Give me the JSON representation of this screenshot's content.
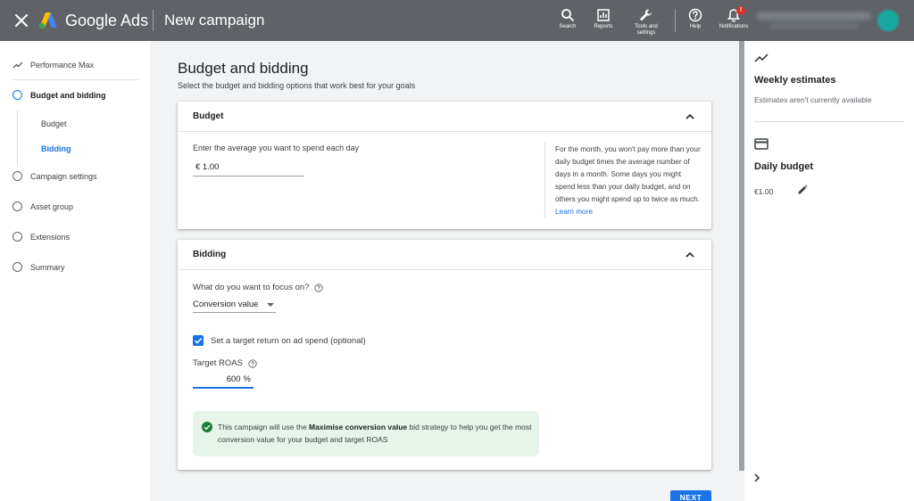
{
  "header": {
    "brand": "Google Ads",
    "title": "New campaign",
    "tools": [
      {
        "label": "Search",
        "icon": "search-icon"
      },
      {
        "label": "Reports",
        "icon": "reports-icon"
      },
      {
        "label": "Tools and",
        "label2": "settings",
        "icon": "wrench-icon"
      },
      {
        "label": "Help",
        "icon": "help-icon"
      },
      {
        "label": "Notifications",
        "icon": "bell-icon",
        "badge": "!"
      }
    ]
  },
  "nav": {
    "campaign_type": "Performance Max",
    "steps": [
      {
        "label": "Budget and bidding",
        "active": true
      },
      {
        "label": "Campaign settings"
      },
      {
        "label": "Asset group"
      },
      {
        "label": "Extensions"
      },
      {
        "label": "Summary"
      }
    ],
    "substeps": [
      {
        "label": "Budget"
      },
      {
        "label": "Bidding",
        "active": true
      }
    ]
  },
  "main": {
    "title": "Budget and bidding",
    "subtitle": "Select the budget and bidding options that work best for your goals",
    "budget": {
      "title": "Budget",
      "label": "Enter the average you want to spend each day",
      "value": "€ 1.00",
      "info": "For the month, you won't pay more than your daily budget times the average number of days in a month. Some days you might spend less than your daily budget, and on others you might spend up to twice as much.",
      "learn_more": "Learn more"
    },
    "bidding": {
      "title": "Bidding",
      "focus_label": "What do you want to focus on?",
      "focus_value": "Conversion value",
      "checkbox_label": "Set a target return on ad spend (optional)",
      "roas_label": "Target ROAS",
      "roas_value": "600",
      "roas_unit": "%",
      "notice_pre": "This campaign will use the ",
      "notice_bold": "Maximise conversion value",
      "notice_post": " bid strategy to help you get the most conversion value for your budget and target ROAS"
    },
    "next_label": "NEXT"
  },
  "right": {
    "weekly_title": "Weekly estimates",
    "weekly_sub": "Estimates aren't currently available",
    "daily_title": "Daily budget",
    "daily_value": "€1.00"
  },
  "colors": {
    "topbar": "#5f6368",
    "accent": "#1a73e8",
    "success_bg": "#e6f4ea",
    "success_icon": "#188038",
    "badge": "#d93025"
  }
}
